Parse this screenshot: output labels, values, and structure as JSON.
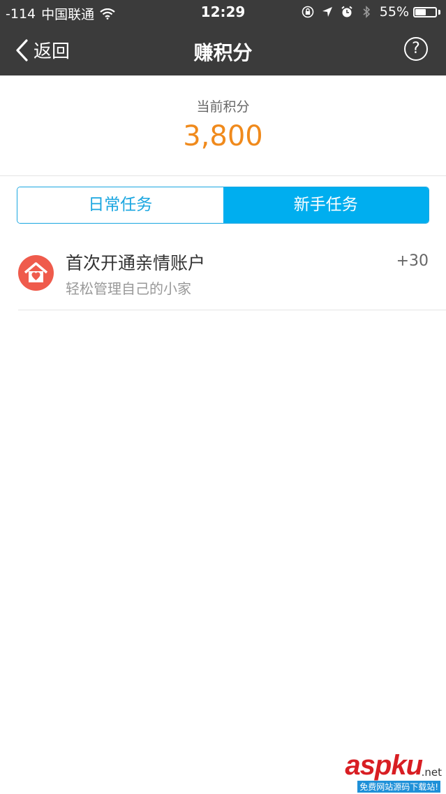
{
  "status_bar": {
    "signal": "-114",
    "carrier": "中国联通",
    "time": "12:29",
    "battery_pct": "55%",
    "battery_level": 0.55
  },
  "nav": {
    "back_label": "返回",
    "title": "赚积分",
    "help_label": "?"
  },
  "points": {
    "label": "当前积分",
    "value": "3,800"
  },
  "tabs": [
    {
      "label": "日常任务",
      "active": false
    },
    {
      "label": "新手任务",
      "active": true
    }
  ],
  "tasks": [
    {
      "title": "首次开通亲情账户",
      "desc": "轻松管理自己的小家",
      "points": "+30",
      "icon": "heart-house-icon"
    }
  ],
  "watermark": {
    "main": "aspku",
    "suffix": ".net",
    "sub": "免费网站源码下载站!"
  },
  "colors": {
    "topbar": "#3b3b3b",
    "accent": "#00aeef",
    "points": "#f08a1c",
    "icon": "#ef5b4c"
  }
}
